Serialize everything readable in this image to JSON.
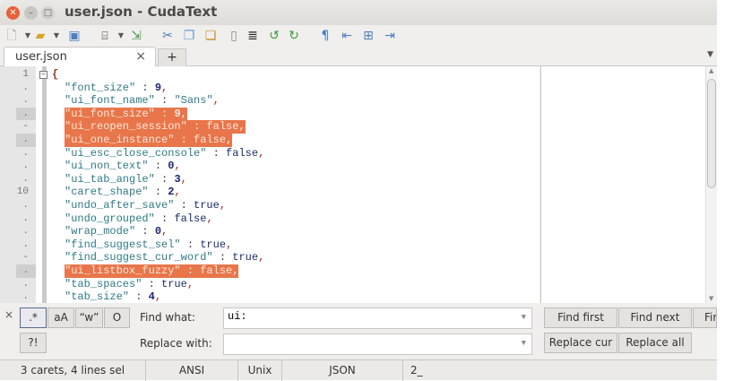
{
  "window": {
    "title": "user.json - CudaText"
  },
  "toolbar": {
    "icons": [
      "new-file-icon",
      "open-file-icon",
      "save-icon",
      "find-icon",
      "goto-icon",
      "cut-icon",
      "copy-icon",
      "paste-icon",
      "delete-icon",
      "select-all-icon",
      "undo-icon",
      "redo-icon",
      "unprinted-chars-icon",
      "unindent-icon",
      "indent-center-icon",
      "indent-icon"
    ]
  },
  "tabs": [
    {
      "label": "user.json",
      "close": "×"
    }
  ],
  "tab_add": "+",
  "editor": {
    "open_brace": "{",
    "lines": [
      {
        "num": "1",
        "key": "",
        "value": "",
        "type": "",
        "sel": false,
        "gsel": false
      },
      {
        "num": ".",
        "key": "\"font_size\"",
        "value": "9",
        "type": "n",
        "sel": false,
        "gsel": false
      },
      {
        "num": ".",
        "key": "\"ui_font_name\"",
        "value": "\"Sans\"",
        "type": "s",
        "sel": false,
        "gsel": false
      },
      {
        "num": ".",
        "key": "\"ui_font_size\"",
        "value": "9",
        "type": "n",
        "sel": true,
        "gsel": true
      },
      {
        "num": "-",
        "key": "\"ui_reopen_session\"",
        "value": "false",
        "type": "b",
        "sel": true,
        "gsel": false
      },
      {
        "num": ".",
        "key": "\"ui_one_instance\"",
        "value": "false",
        "type": "b",
        "sel": true,
        "gsel": true
      },
      {
        "num": ".",
        "key": "\"ui_esc_close_console\"",
        "value": "false",
        "type": "b",
        "sel": false,
        "gsel": false
      },
      {
        "num": ".",
        "key": "\"ui_non_text\"",
        "value": "0",
        "type": "n",
        "sel": false,
        "gsel": false
      },
      {
        "num": ".",
        "key": "\"ui_tab_angle\"",
        "value": "3",
        "type": "n",
        "sel": false,
        "gsel": false
      },
      {
        "num": "10",
        "key": "\"caret_shape\"",
        "value": "2",
        "type": "n",
        "sel": false,
        "gsel": false
      },
      {
        "num": ".",
        "key": "\"undo_after_save\"",
        "value": "true",
        "type": "b",
        "sel": false,
        "gsel": false
      },
      {
        "num": ".",
        "key": "\"undo_grouped\"",
        "value": "false",
        "type": "b",
        "sel": false,
        "gsel": false
      },
      {
        "num": ".",
        "key": "\"wrap_mode\"",
        "value": "0",
        "type": "n",
        "sel": false,
        "gsel": false
      },
      {
        "num": ".",
        "key": "\"find_suggest_sel\"",
        "value": "true",
        "type": "b",
        "sel": false,
        "gsel": false
      },
      {
        "num": "-",
        "key": "\"find_suggest_cur_word\"",
        "value": "true",
        "type": "b",
        "sel": false,
        "gsel": false
      },
      {
        "num": ".",
        "key": "\"ui_listbox_fuzzy\"",
        "value": "false",
        "type": "b",
        "sel": true,
        "gsel": true
      },
      {
        "num": ".",
        "key": "\"tab_spaces\"",
        "value": "true",
        "type": "b",
        "sel": false,
        "gsel": false
      },
      {
        "num": ".",
        "key": "\"tab_size\"",
        "value": "4",
        "type": "n",
        "sel": false,
        "gsel": false
      }
    ],
    "colon": " : ",
    "comma": ","
  },
  "findbar": {
    "close": "×",
    "opt_regex": ".*",
    "opt_case": "aA",
    "opt_words": "“w”",
    "opt_o": "O",
    "opt_confirm": "?!",
    "find_label": "Find what:",
    "find_value": "ui:",
    "replace_label": "Replace with:",
    "replace_value": "",
    "find_first": "Find first",
    "find_next": "Find next",
    "find_prev": "Fir",
    "replace_cur": "Replace cur",
    "replace_all": "Replace all"
  },
  "status": {
    "carets": "3 carets, 4 lines sel",
    "encoding": "ANSI",
    "line_ends": "Unix",
    "lexer": "JSON",
    "tab": "2_"
  },
  "colors": {
    "selection": "#e8764a",
    "key": "#2f7a86",
    "number": "#1b2372"
  }
}
